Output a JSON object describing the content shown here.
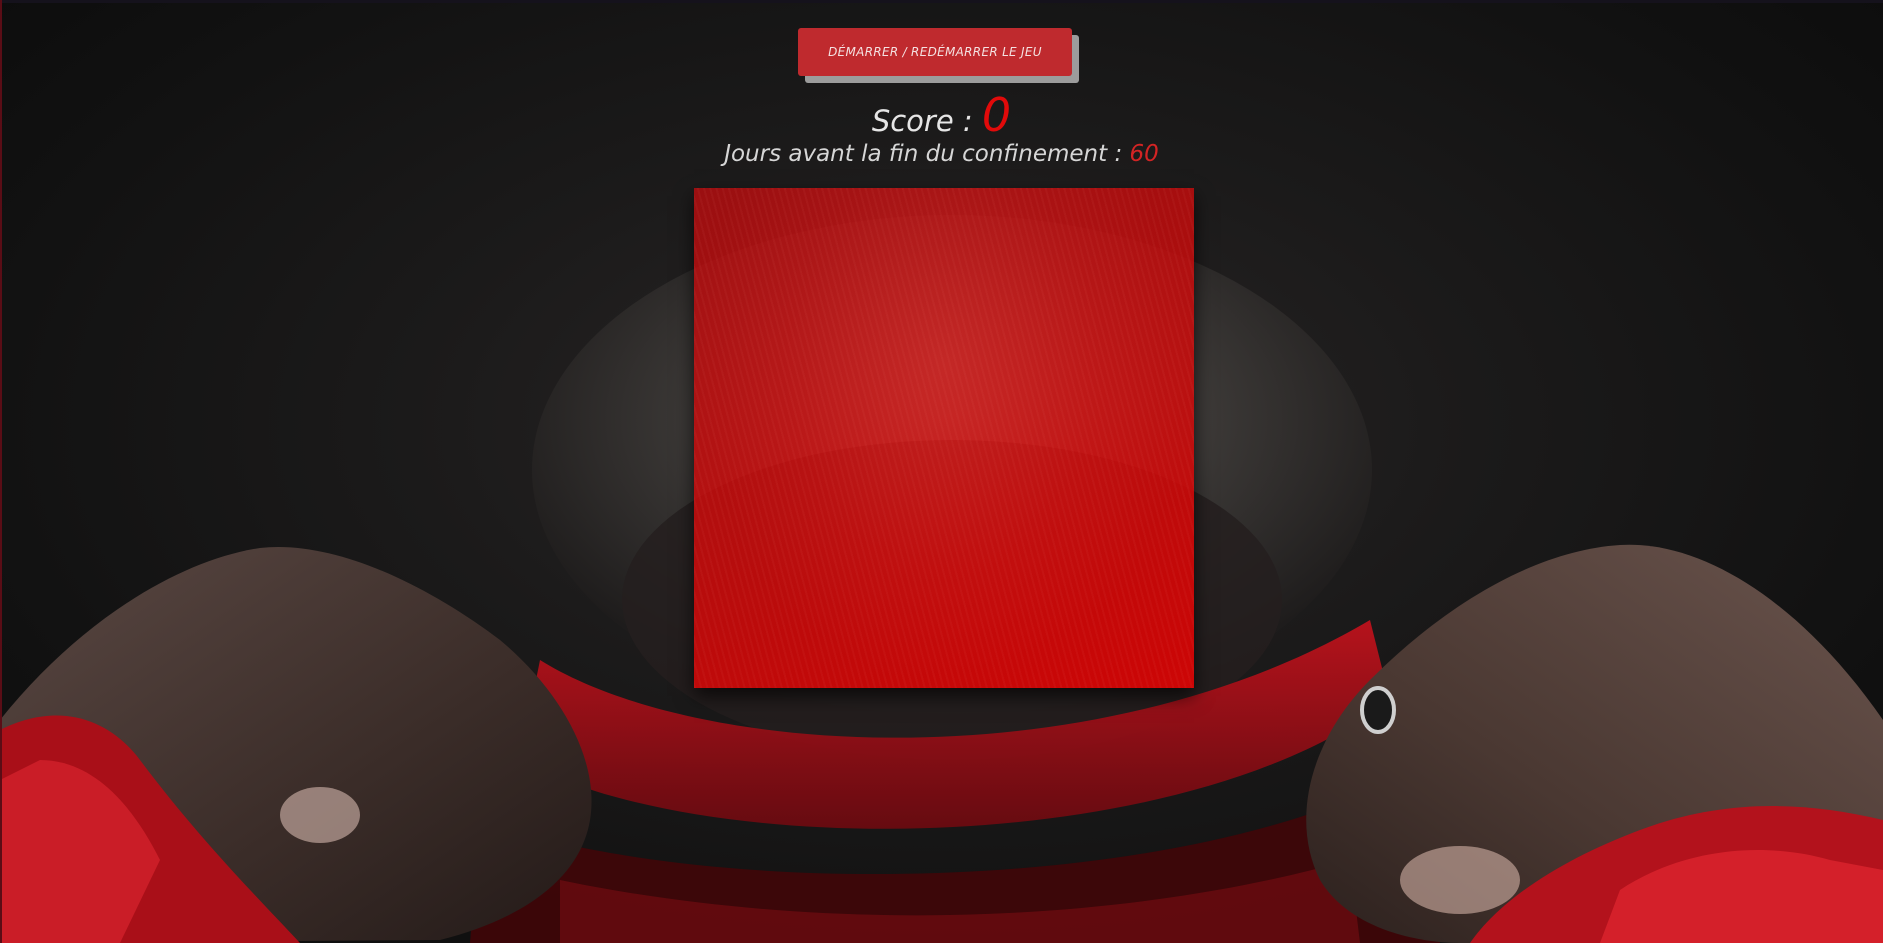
{
  "game": {
    "start_button_label": "DÉMARRER / REDÉMARRER LE JEU",
    "score_label": "Score : ",
    "score_value": "0",
    "days_label": "Jours avant la fin du confinement : ",
    "days_value": "60"
  },
  "colors": {
    "accent": "#bf2a2e",
    "score_value": "#e10a0a",
    "game_area": "#cc0a0a"
  }
}
